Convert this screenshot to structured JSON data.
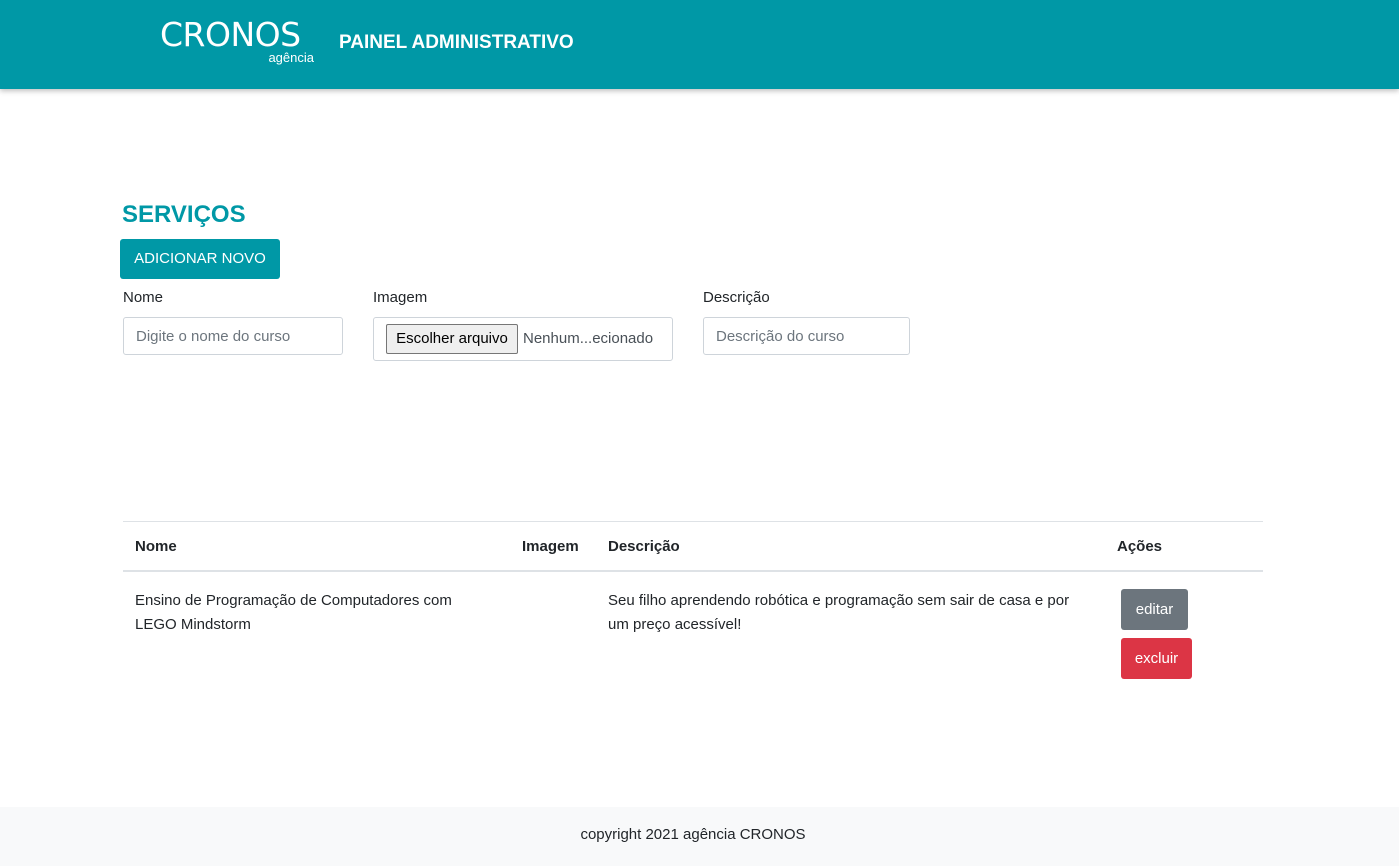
{
  "header": {
    "logo_main": "CRONOS",
    "logo_sub": "agência",
    "title": "PAINEL ADMINISTRATIVO"
  },
  "services": {
    "title": "SERVIÇOS",
    "add_button": "ADICIONAR NOVO",
    "form": {
      "name_label": "Nome",
      "name_placeholder": "Digite o nome do curso",
      "image_label": "Imagem",
      "file_button": "Escolher arquivo",
      "file_status": "Nenhum...ecionado",
      "description_label": "Descrição",
      "description_placeholder": "Descrição do curso"
    },
    "table": {
      "headers": [
        "Nome",
        "Imagem",
        "Descrição",
        "Ações"
      ],
      "rows": [
        {
          "name": "Ensino de Programação de Computadores com LEGO Mindstorm",
          "image": "",
          "description": "Seu filho aprendendo robótica e programação sem sair de casa e por um preço acessível!",
          "edit_label": "editar",
          "delete_label": "excluir"
        }
      ]
    }
  },
  "footer": {
    "text": "copyright 2021 agência CRONOS"
  },
  "colors": {
    "brand": "#0098a6",
    "edit": "#6c757d",
    "delete": "#dc3545"
  }
}
